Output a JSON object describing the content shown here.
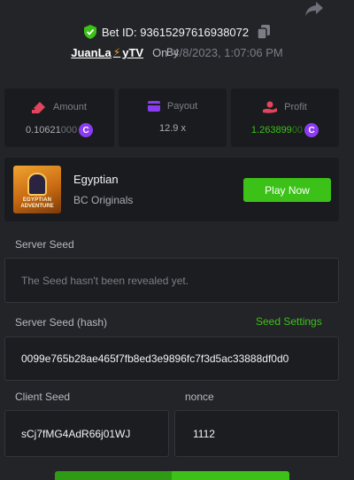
{
  "header": {
    "bet_id": "Bet ID: 93615297616938072",
    "by_label": "By",
    "user_pre": "JuanLa",
    "user_post": "yTV",
    "on_label": "On",
    "date": "4/8/2023, 1:07:06 PM"
  },
  "stats": {
    "amount": {
      "label": "Amount",
      "value_main": "0.10621",
      "value_dim": "000"
    },
    "payout": {
      "label": "Payout",
      "value": "12.9 x"
    },
    "profit": {
      "label": "Profit",
      "value_main": "1.263899",
      "value_dim": "00"
    }
  },
  "game": {
    "title": "Egyptian",
    "subtitle": "BC Originals",
    "thumb_line1": "EGYPTIAN",
    "thumb_line2": "ADVENTURE",
    "play_label": "Play Now"
  },
  "fields": {
    "server_seed_label": "Server Seed",
    "server_seed_value": "The Seed hasn't been revealed yet.",
    "server_hash_label": "Server Seed (hash)",
    "seed_settings_label": "Seed Settings",
    "server_hash_value": "0099e765b28ae465f7fb8ed3e9896fc7f3d5ac33888df0d0",
    "client_seed_label": "Client Seed",
    "client_seed_value": "sCj7fMG4AdR66j01WJ",
    "nonce_label": "nonce",
    "nonce_value": "1112"
  },
  "colors": {
    "accent_green": "#3bc117",
    "coin_purple": "#8a3cf0",
    "background": "#232428",
    "card": "#1a1b1e"
  },
  "icons": {
    "share": "share-icon",
    "shield": "shield-check-icon",
    "copy": "copy-icon",
    "amount": "ticket-icon",
    "payout": "wallet-icon",
    "profit": "hand-coin-icon",
    "coin": "coin-icon"
  }
}
